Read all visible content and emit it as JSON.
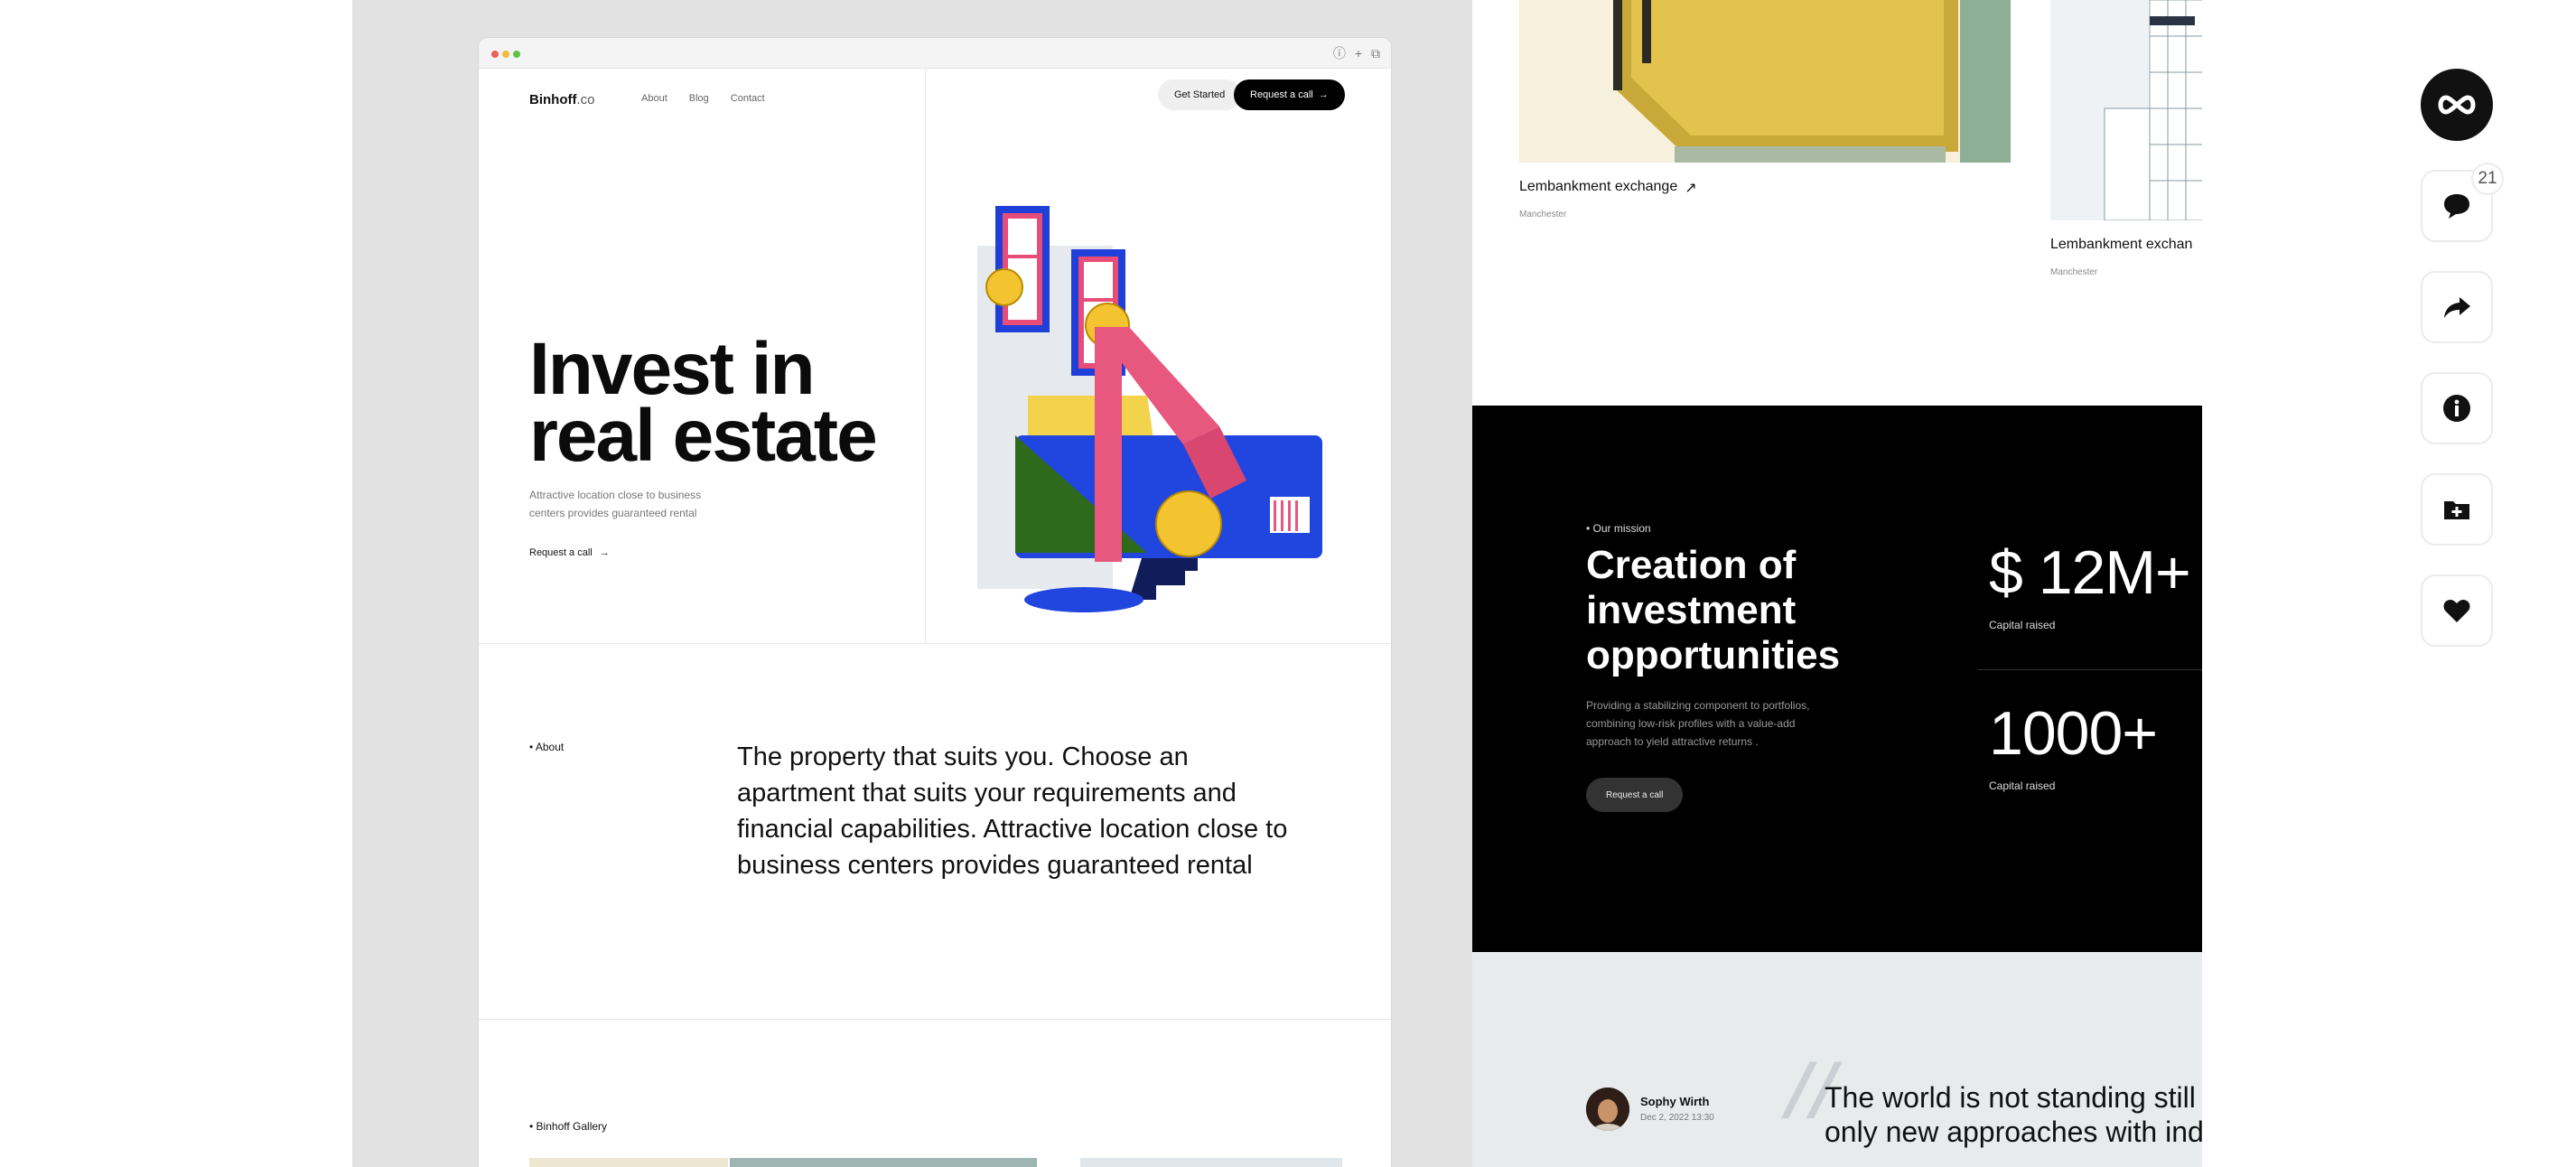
{
  "browser": {
    "toolbar_icons": [
      "info-icon",
      "plus-icon",
      "copy-icon"
    ]
  },
  "site": {
    "logo_main": "Binhoff",
    "logo_suffix": ".co",
    "nav": [
      "About",
      "Blog",
      "Contact"
    ],
    "get_started": "Get Started",
    "request_call": "Request a call",
    "hero_line1": "Invest in",
    "hero_line2": "real estate",
    "hero_sub": "Attractive location close to business centers provides guaranteed rental",
    "hero_link": "Request a call",
    "about_label": "About",
    "about_text": "The property that suits you. Choose an apartment that suits your requirements and financial capabilities. Attractive location close to business centers provides guaranteed rental",
    "gallery_label": "Binhoff Gallery"
  },
  "listings": [
    {
      "title": "Lembankment exchange",
      "city": "Manchester"
    },
    {
      "title": "Lembankment exchan",
      "city": "Manchester"
    }
  ],
  "mission": {
    "label": "Our mission",
    "title": "Creation of investment opportunities",
    "desc": "Providing a stabilizing component to portfolios, combining low-risk profiles with a value-add approach to yield attractive returns .",
    "button": "Request a call",
    "stats": [
      {
        "value": "$ 12M+",
        "label": "Capital raised"
      },
      {
        "value": "1000+",
        "label": "Capital raised"
      }
    ]
  },
  "testimonial": {
    "name": "Sophy Wirth",
    "date": "Dec 2, 2022 13:30",
    "quote_line1": "The world is not standing still ar",
    "quote_line2": "only new approaches with indiv"
  },
  "rail": {
    "comment_count": "21",
    "icons": [
      "brand-logo-icon",
      "comment-icon",
      "share-icon",
      "info-icon",
      "add-folder-icon",
      "heart-icon"
    ]
  }
}
